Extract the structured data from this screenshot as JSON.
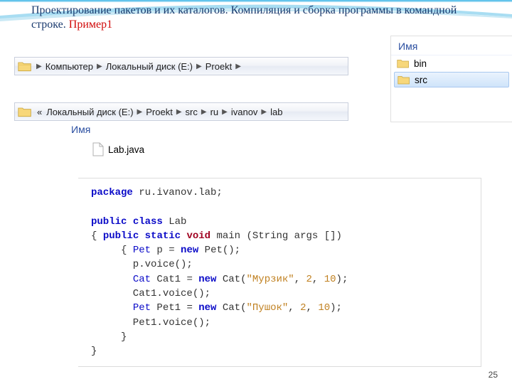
{
  "title": {
    "main": "Проектирование пакетов и их каталогов. Компиляция и сборка программы в командной строке.",
    "example": "Пример1"
  },
  "breadcrumb1": {
    "parts": [
      "Компьютер",
      "Локальный диск (E:)",
      "Proekt"
    ]
  },
  "breadcrumb2": {
    "prefix": "«",
    "parts": [
      "Локальный диск (E:)",
      "Proekt",
      "src",
      "ru",
      "ivanov",
      "lab"
    ]
  },
  "side": {
    "header": "Имя",
    "folders": [
      {
        "name": "bin",
        "selected": false
      },
      {
        "name": "src",
        "selected": true
      }
    ]
  },
  "name_header": "Имя",
  "file": {
    "name": "Lab.java"
  },
  "code": {
    "l1a": "package",
    "l1b": " ru.ivanov.lab;",
    "l2a": "public",
    "l2b": " class",
    "l2c": " Lab",
    "l3a": "{ ",
    "l3b": "public",
    "l3c": " static",
    "l3d": " void",
    "l3e": " main (String args [])",
    "l4a": "     { ",
    "l4b": "Pet",
    "l4c": " p = ",
    "l4d": "new",
    "l4e": " Pet();",
    "l5": "       p.voice();",
    "l6a": "       ",
    "l6b": "Cat",
    "l6c": " Cat1 = ",
    "l6d": "new",
    "l6e": " Cat(",
    "l6f": "\"Мурзик\"",
    "l6g": ", ",
    "l6h": "2",
    "l6i": ", ",
    "l6j": "10",
    "l6k": ");",
    "l7": "       Cat1.voice();",
    "l8a": "       ",
    "l8b": "Pet",
    "l8c": " Pet1 = ",
    "l8d": "new",
    "l8e": " Cat(",
    "l8f": "\"Пушок\"",
    "l8g": ", ",
    "l8h": "2",
    "l8i": ", ",
    "l8j": "10",
    "l8k": ");",
    "l9": "       Pet1.voice();",
    "l10": "     }",
    "l11": "}"
  },
  "page_number": "25"
}
